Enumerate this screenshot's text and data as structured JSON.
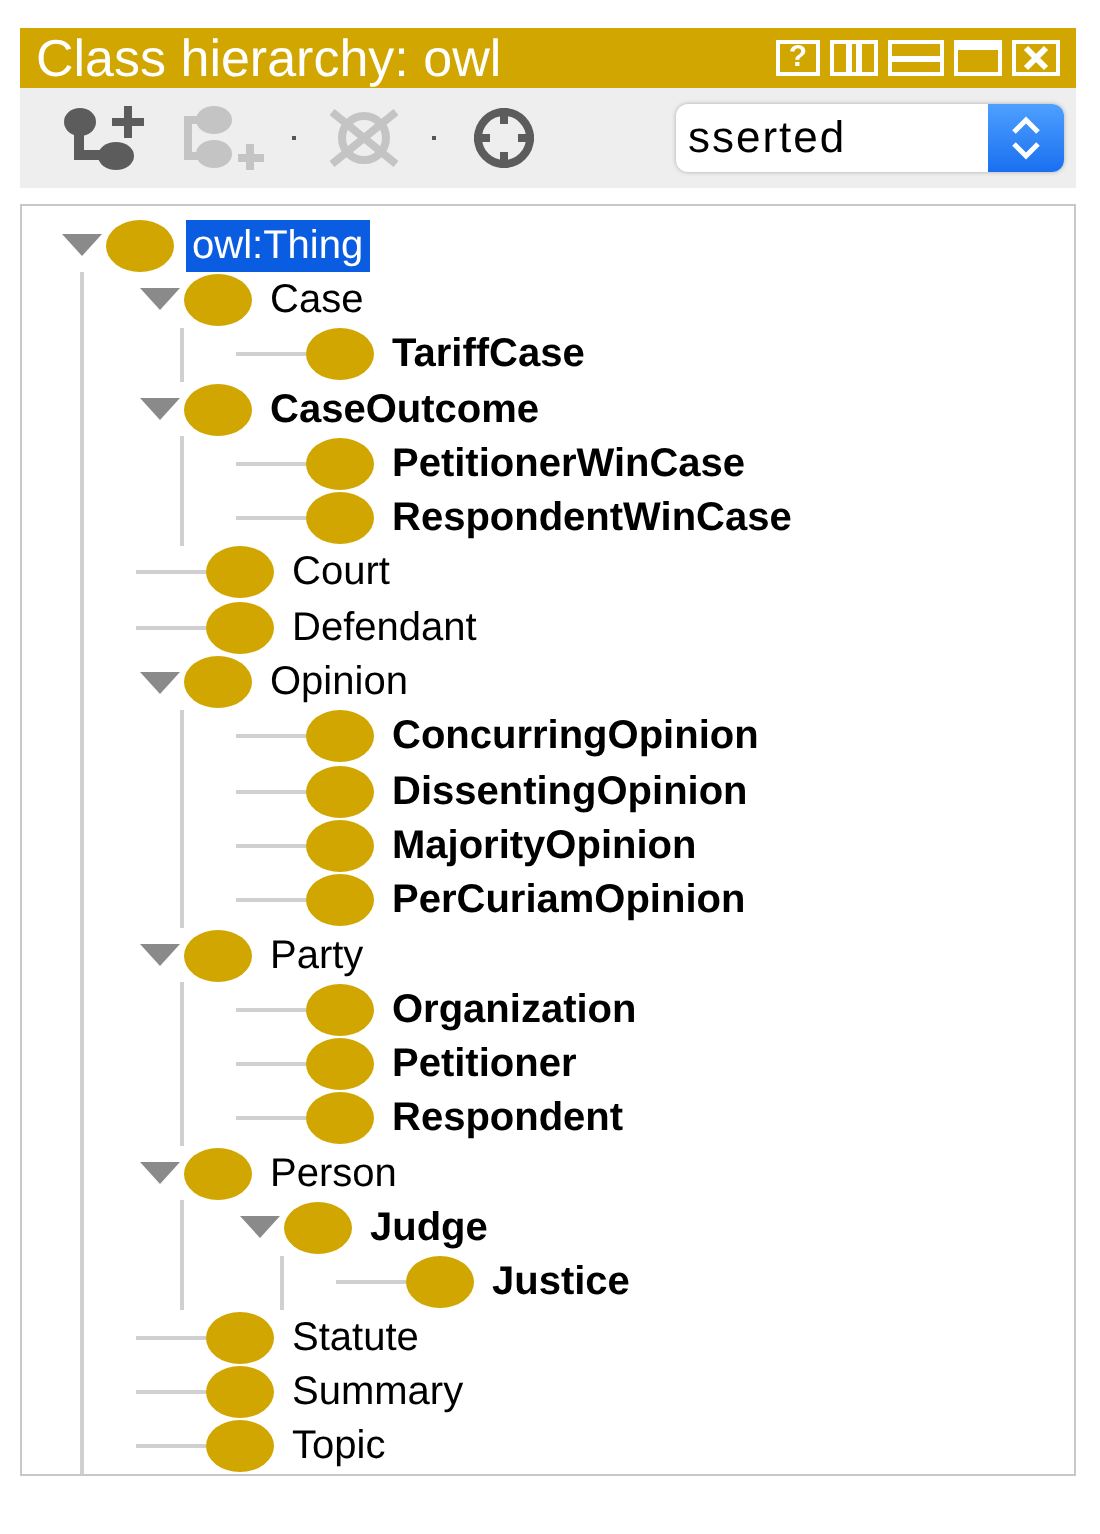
{
  "window": {
    "title": "Class hierarchy: owl",
    "help_button": "?"
  },
  "toolbar": {
    "buttons": [
      {
        "kind": "add-subclass",
        "disabled": false
      },
      {
        "kind": "add-sibling",
        "disabled": true
      },
      {
        "kind": "delete",
        "disabled": true
      },
      {
        "kind": "find",
        "disabled": false
      }
    ],
    "view_select": {
      "value": "sserted"
    }
  },
  "tree": [
    {
      "label": "owl:Thing",
      "bold": false,
      "selected": true,
      "expanded": true,
      "children": [
        {
          "label": "Case",
          "bold": false,
          "selected": false,
          "expanded": true,
          "children": [
            {
              "label": "TariffCase",
              "bold": true,
              "selected": false
            }
          ]
        },
        {
          "label": "CaseOutcome",
          "bold": true,
          "selected": false,
          "expanded": true,
          "children": [
            {
              "label": "PetitionerWinCase",
              "bold": true,
              "selected": false
            },
            {
              "label": "RespondentWinCase",
              "bold": true,
              "selected": false
            }
          ]
        },
        {
          "label": "Court",
          "bold": false,
          "selected": false
        },
        {
          "label": "Defendant",
          "bold": false,
          "selected": false
        },
        {
          "label": "Opinion",
          "bold": false,
          "selected": false,
          "expanded": true,
          "children": [
            {
              "label": "ConcurringOpinion",
              "bold": true,
              "selected": false
            },
            {
              "label": "DissentingOpinion",
              "bold": true,
              "selected": false
            },
            {
              "label": "MajorityOpinion",
              "bold": true,
              "selected": false
            },
            {
              "label": "PerCuriamOpinion",
              "bold": true,
              "selected": false
            }
          ]
        },
        {
          "label": "Party",
          "bold": false,
          "selected": false,
          "expanded": true,
          "children": [
            {
              "label": "Organization",
              "bold": true,
              "selected": false
            },
            {
              "label": "Petitioner",
              "bold": true,
              "selected": false
            },
            {
              "label": "Respondent",
              "bold": true,
              "selected": false
            }
          ]
        },
        {
          "label": "Person",
          "bold": false,
          "selected": false,
          "expanded": true,
          "children": [
            {
              "label": "Judge",
              "bold": true,
              "selected": false,
              "expanded": true,
              "children": [
                {
                  "label": "Justice",
                  "bold": true,
                  "selected": false
                }
              ]
            }
          ]
        },
        {
          "label": "Statute",
          "bold": false,
          "selected": false
        },
        {
          "label": "Summary",
          "bold": false,
          "selected": false
        },
        {
          "label": "Topic",
          "bold": false,
          "selected": false
        }
      ]
    }
  ]
}
